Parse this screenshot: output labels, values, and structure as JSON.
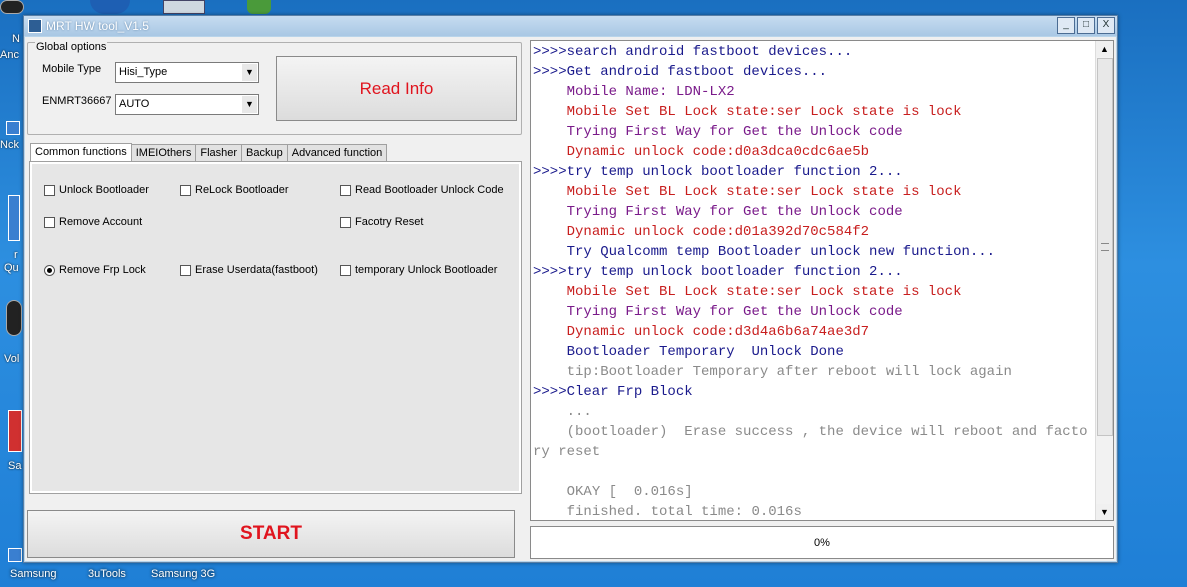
{
  "desktop": {
    "bottom_labels": [
      "Samsung",
      "3uTools",
      "Samsung 3G"
    ],
    "side_labels": [
      "N",
      "Anc",
      "Nck",
      "r",
      "Qu",
      "Vol",
      "Sa"
    ]
  },
  "window": {
    "title": "MRT HW tool_V1.5",
    "controls": [
      "_",
      "□",
      "X"
    ]
  },
  "global_options": {
    "legend": "Global options",
    "mobile_type_label": "Mobile Type",
    "mobile_type_value": "Hisi_Type",
    "enmrt_label": "ENMRT36667",
    "enmrt_value": "AUTO",
    "read_info_label": "Read Info"
  },
  "tabs": [
    "Common functions",
    "IMEIOthers",
    "Flasher",
    "Backup",
    "Advanced function"
  ],
  "active_tab": "Common functions",
  "functions": [
    {
      "label": "Unlock Bootloader",
      "type": "checkbox",
      "checked": false
    },
    {
      "label": "ReLock Bootloader",
      "type": "checkbox",
      "checked": false
    },
    {
      "label": "Read Bootloader Unlock Code",
      "type": "checkbox",
      "checked": false
    },
    {
      "label": "Remove Account",
      "type": "checkbox",
      "checked": false
    },
    {
      "label": "Facotry Reset",
      "type": "checkbox",
      "checked": false
    },
    {
      "label": "Remove Frp Lock",
      "type": "radio",
      "checked": true
    },
    {
      "label": "Erase Userdata(fastboot)",
      "type": "checkbox",
      "checked": false
    },
    {
      "label": "temporary Unlock Bootloader",
      "type": "checkbox",
      "checked": false
    }
  ],
  "start_label": "START",
  "log": {
    "colors": {
      "blue": "#1a1a8c",
      "red": "#c81e1e",
      "purple": "#7a1a8a",
      "gray": "#8a8a8a"
    },
    "lines": [
      {
        "text": ">>>>search android fastboot devices...",
        "color": "blue"
      },
      {
        "text": ">>>>Get android fastboot devices...",
        "color": "blue"
      },
      {
        "text": "    Mobile Name: LDN-LX2",
        "color": "purple"
      },
      {
        "text": "    Mobile Set BL Lock state:ser Lock state is lock",
        "color": "red"
      },
      {
        "text": "    Trying First Way for Get the Unlock code",
        "color": "purple"
      },
      {
        "text": "    Dynamic unlock code:d0a3dca0cdc6ae5b",
        "color": "red"
      },
      {
        "text": ">>>>try temp unlock bootloader function 2...",
        "color": "blue"
      },
      {
        "text": "    Mobile Set BL Lock state:ser Lock state is lock",
        "color": "red"
      },
      {
        "text": "    Trying First Way for Get the Unlock code",
        "color": "purple"
      },
      {
        "text": "    Dynamic unlock code:d01a392d70c584f2",
        "color": "red"
      },
      {
        "text": "    Try Qualcomm temp Bootloader unlock new function...",
        "color": "blue"
      },
      {
        "text": ">>>>try temp unlock bootloader function 2...",
        "color": "blue"
      },
      {
        "text": "    Mobile Set BL Lock state:ser Lock state is lock",
        "color": "red"
      },
      {
        "text": "    Trying First Way for Get the Unlock code",
        "color": "purple"
      },
      {
        "text": "    Dynamic unlock code:d3d4a6b6a74ae3d7",
        "color": "red"
      },
      {
        "text": "    Bootloader Temporary  Unlock Done",
        "color": "blue"
      },
      {
        "text": "    tip:Bootloader Temporary after reboot will lock again",
        "color": "gray"
      },
      {
        "text": ">>>>Clear Frp Block",
        "color": "blue"
      },
      {
        "text": "    ...",
        "color": "gray"
      },
      {
        "text": "    (bootloader)  Erase success , the device will reboot and factory reset",
        "color": "gray"
      },
      {
        "text": " ",
        "color": "gray"
      },
      {
        "text": "    OKAY [  0.016s]",
        "color": "gray"
      },
      {
        "text": "    finished. total time: 0.016s",
        "color": "gray"
      }
    ]
  },
  "progress_text": "0%"
}
